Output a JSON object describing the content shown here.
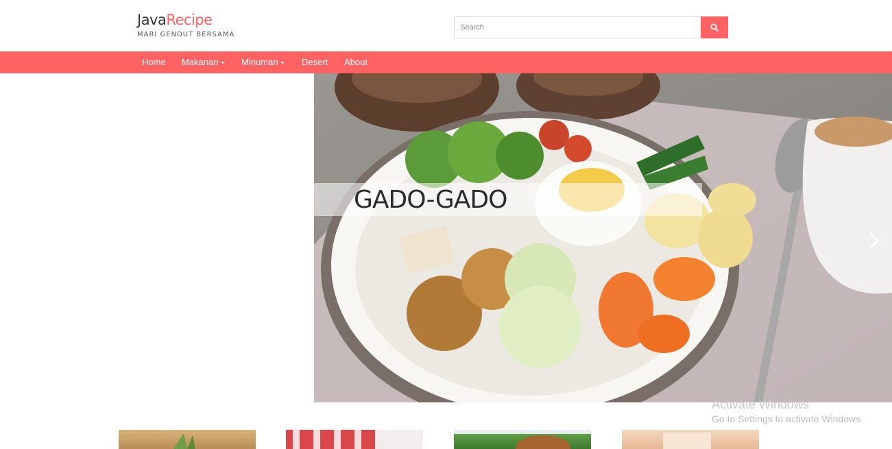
{
  "brand": {
    "name_primary": "Java",
    "name_accent": "Recipe",
    "tagline": "MARI GENDUT BERSAMA",
    "accent_color": "#ff6262"
  },
  "search": {
    "placeholder": "Search",
    "button_icon": "search-icon"
  },
  "nav": {
    "items": [
      {
        "label": "Home",
        "has_dropdown": false
      },
      {
        "label": "Makanan",
        "has_dropdown": true
      },
      {
        "label": "Minuman",
        "has_dropdown": true
      },
      {
        "label": "Desert",
        "has_dropdown": false
      },
      {
        "label": "About",
        "has_dropdown": false
      }
    ]
  },
  "carousel": {
    "caption": "GADO-GADO",
    "next_icon": "chevron-right-icon"
  },
  "watermark": {
    "title": "Activate Windows",
    "subtitle": "Go to Settings to activate Windows."
  },
  "thumbnails": [
    {
      "icon": "food-photo"
    },
    {
      "icon": "food-photo"
    },
    {
      "icon": "food-photo"
    },
    {
      "icon": "food-photo"
    }
  ]
}
